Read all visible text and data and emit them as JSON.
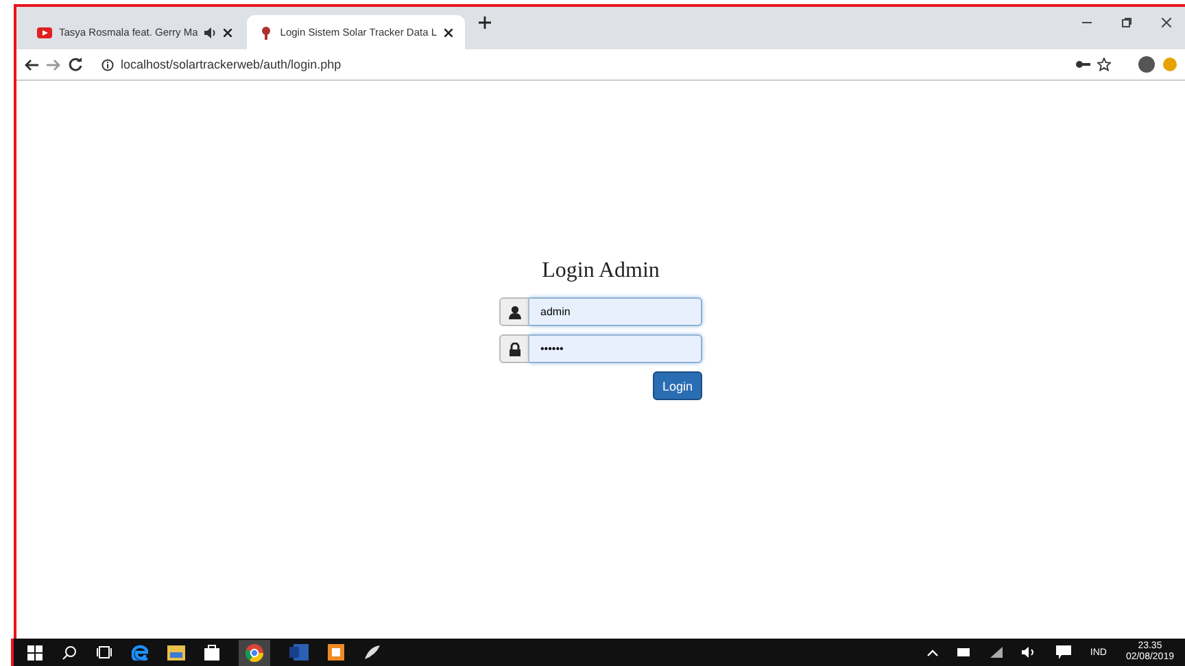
{
  "browser": {
    "tabs": [
      {
        "title": "Tasya Rosmala feat. Gerry Ma",
        "audio": true,
        "selected": false
      },
      {
        "title": "Login Sistem Solar Tracker Data L",
        "audio": false,
        "selected": true
      }
    ],
    "url": "localhost/solartrackerweb/auth/login.php"
  },
  "login": {
    "title": "Login Admin",
    "username": "admin",
    "password": "••••••",
    "button": "Login"
  },
  "taskbar": {
    "language": "IND",
    "time": "23.35",
    "date": "02/08/2019"
  }
}
